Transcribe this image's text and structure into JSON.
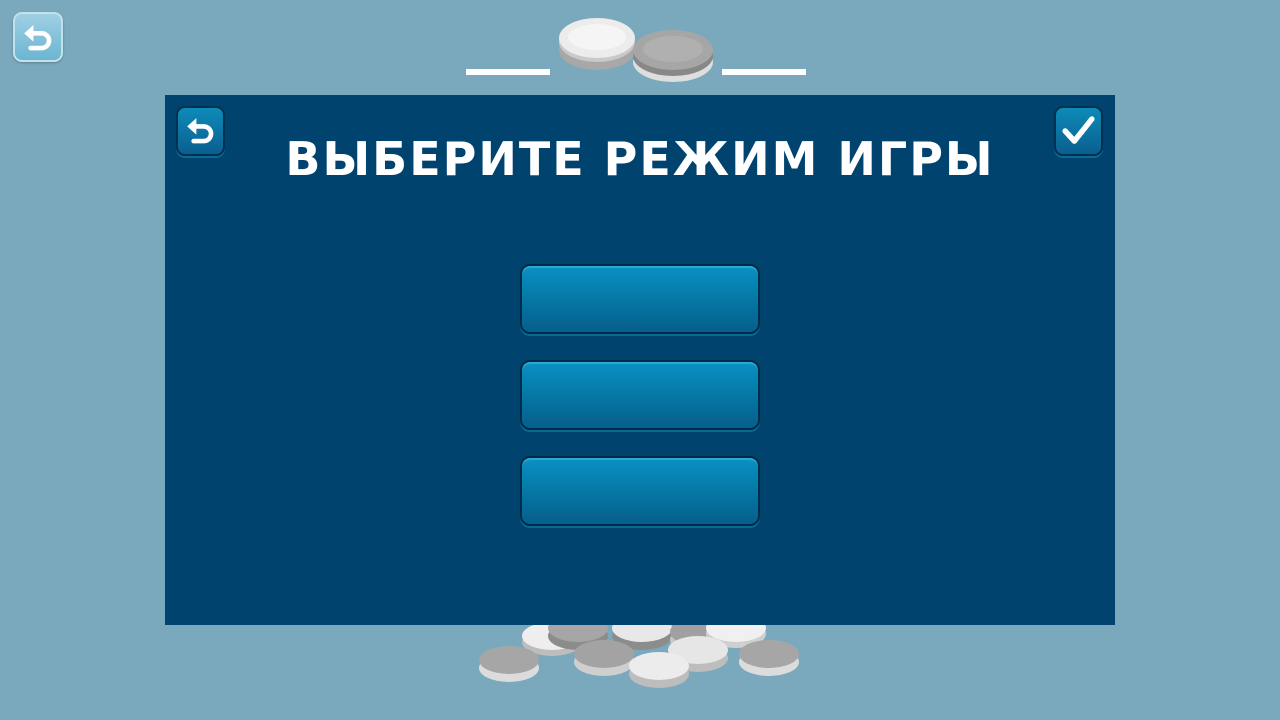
{
  "screen": {
    "title": "ВЫБЕРИТЕ РЕЖИМ ИГРЫ"
  },
  "buttons": {
    "background_back_icon": "undo-arrow",
    "panel_back_icon": "undo-arrow",
    "panel_confirm_icon": "checkmark"
  },
  "game_modes": [
    {
      "label": ""
    },
    {
      "label": ""
    },
    {
      "label": ""
    }
  ],
  "colors": {
    "background": "#7aa9bd",
    "panel": "#00436f",
    "button": "#0678a6",
    "white_chip": "#e8e8e8",
    "gray_chip": "#a3a3a3"
  }
}
